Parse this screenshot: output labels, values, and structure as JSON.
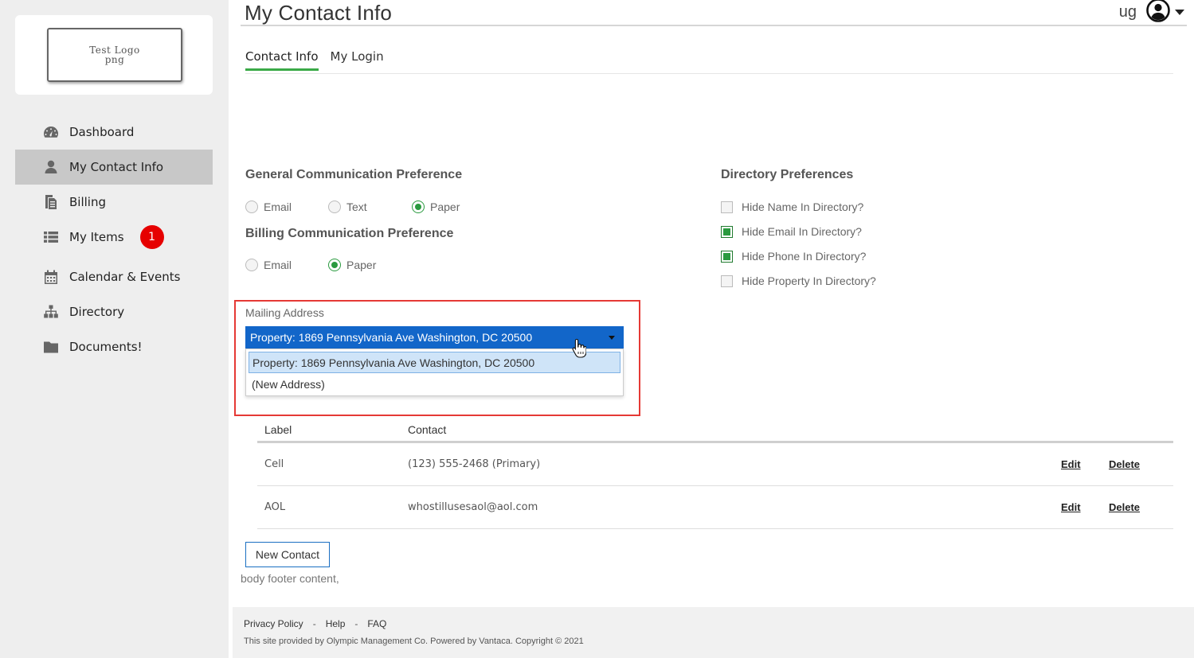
{
  "sidebar": {
    "logo": {
      "line1": "Test Logo",
      "line2": "png"
    },
    "items": [
      {
        "label": "Dashboard",
        "icon": "dashboard-icon",
        "active": false
      },
      {
        "label": "My Contact Info",
        "icon": "user-icon",
        "active": true
      },
      {
        "label": "Billing",
        "icon": "billing-icon",
        "active": false
      },
      {
        "label": "My Items",
        "icon": "list-icon",
        "active": false,
        "badge": "1"
      },
      {
        "label": "Calendar & Events",
        "icon": "calendar-icon",
        "active": false
      },
      {
        "label": "Directory",
        "icon": "directory-icon",
        "active": false
      },
      {
        "label": "Documents!",
        "icon": "folder-icon",
        "active": false
      }
    ]
  },
  "header": {
    "title": "My Contact Info",
    "user_initials": "ug"
  },
  "tabs": [
    {
      "label": "Contact Info",
      "active": true
    },
    {
      "label": "My Login",
      "active": false
    }
  ],
  "general_pref": {
    "title": "General Communication Preference",
    "options": [
      {
        "label": "Email",
        "checked": false
      },
      {
        "label": "Text",
        "checked": false
      },
      {
        "label": "Paper",
        "checked": true
      }
    ]
  },
  "billing_pref": {
    "title": "Billing Communication Preference",
    "options": [
      {
        "label": "Email",
        "checked": false
      },
      {
        "label": "Paper",
        "checked": true
      }
    ]
  },
  "directory_pref": {
    "title": "Directory Preferences",
    "options": [
      {
        "label": "Hide Name In Directory?",
        "checked": false
      },
      {
        "label": "Hide Email In Directory?",
        "checked": true
      },
      {
        "label": "Hide Phone In Directory?",
        "checked": true
      },
      {
        "label": "Hide Property In Directory?",
        "checked": false
      }
    ]
  },
  "mailing": {
    "label": "Mailing Address",
    "selected": "Property: 1869 Pennsylvania Ave Washington, DC 20500",
    "options": [
      "Property: 1869 Pennsylvania Ave Washington, DC 20500",
      "(New Address)"
    ]
  },
  "contacts": {
    "headers": {
      "label": "Label",
      "contact": "Contact"
    },
    "rows": [
      {
        "label": "Cell",
        "contact": "(123) 555-2468 (Primary)",
        "edit": "Edit",
        "delete": "Delete"
      },
      {
        "label": "AOL",
        "contact": "whostillusesaol@aol.com",
        "edit": "Edit",
        "delete": "Delete"
      }
    ],
    "new_button": "New Contact"
  },
  "body_footer": "body footer content,",
  "footer": {
    "links": [
      "Privacy Policy",
      "Help",
      "FAQ"
    ],
    "separator": "-",
    "copyright": "This site provided by Olympic Management Co. Powered by Vantaca. Copyright © 2021"
  },
  "colors": {
    "accent_green": "#2a9a3f",
    "select_blue": "#1266c9",
    "highlight_red": "#e53935",
    "badge_red": "#e60000"
  }
}
